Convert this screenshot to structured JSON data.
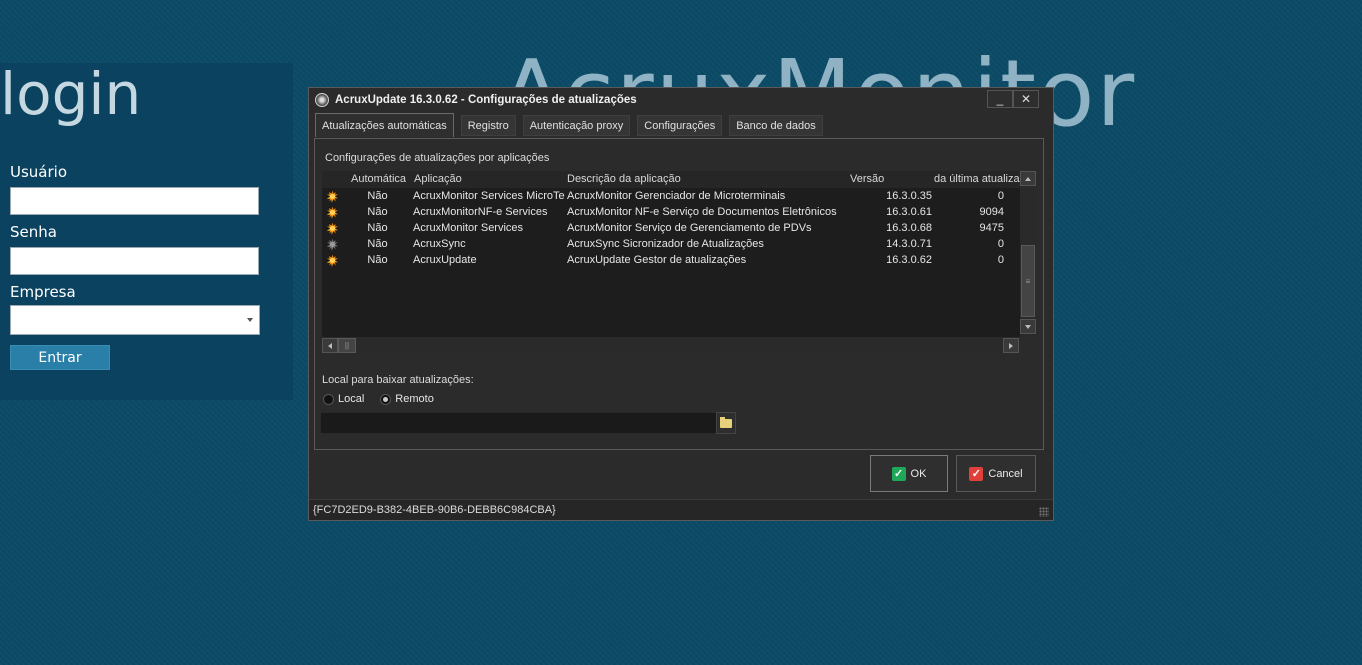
{
  "background": {
    "app_title": "AcruxMonitor"
  },
  "login": {
    "title": "login",
    "user_label": "Usuário",
    "user_value": "",
    "password_label": "Senha",
    "password_value": "",
    "company_label": "Empresa",
    "company_value": "",
    "submit_label": "Entrar"
  },
  "dialog": {
    "title": "AcruxUpdate 16.3.0.62 - Configurações de atualizações",
    "minimize_label": "_",
    "close_label": "✕",
    "tabs": [
      {
        "label": "Atualizações automáticas",
        "active": true
      },
      {
        "label": "Registro",
        "active": false
      },
      {
        "label": "Autenticação proxy",
        "active": false
      },
      {
        "label": "Configurações",
        "active": false
      },
      {
        "label": "Banco de dados",
        "active": false
      }
    ],
    "section_label": "Configurações de atualizações por aplicações",
    "grid": {
      "columns": [
        "Automática",
        "Aplicação",
        "Descrição da aplicação",
        "Versão",
        "da última atualização"
      ],
      "rows": [
        {
          "icon": "orange-star-icon",
          "auto": "Não",
          "app": "AcruxMonitor Services MicroTer",
          "desc": "AcruxMonitor Gerenciador de Microterminais",
          "version": "16.3.0.35",
          "last": "0"
        },
        {
          "icon": "orange-star-icon",
          "auto": "Não",
          "app": "AcruxMonitorNF-e Services",
          "desc": "AcruxMonitor NF-e Serviço de Documentos Eletrônicos",
          "version": "16.3.0.61",
          "last": "9094"
        },
        {
          "icon": "orange-star-icon",
          "auto": "Não",
          "app": "AcruxMonitor Services",
          "desc": "AcruxMonitor Serviço de Gerenciamento de PDVs",
          "version": "16.3.0.68",
          "last": "9475"
        },
        {
          "icon": "gray-star-icon",
          "auto": "Não",
          "app": "AcruxSync",
          "desc": "AcruxSync Sicronizador de Atualizações",
          "version": "14.3.0.71",
          "last": "0"
        },
        {
          "icon": "orange-star-icon",
          "auto": "Não",
          "app": "AcruxUpdate",
          "desc": "AcruxUpdate Gestor de atualizações",
          "version": "16.3.0.62",
          "last": "0"
        }
      ]
    },
    "download_label": "Local para baixar atualizações:",
    "radio_local": "Local",
    "radio_remote": "Remoto",
    "selected_option": "Remoto",
    "path_value": "",
    "ok_label": "OK",
    "cancel_label": "Cancel",
    "status_text": "{FC7D2ED9-B382-4BEB-90B6-DEBB6C984CBA}"
  },
  "colors": {
    "desktop": "#0b4a66",
    "login_panel": "#0a4260",
    "login_button": "#2a7fa8",
    "dialog_bg": "#2b2b2b",
    "ok_check": "#1fa85a",
    "cancel_check": "#e0403a"
  }
}
